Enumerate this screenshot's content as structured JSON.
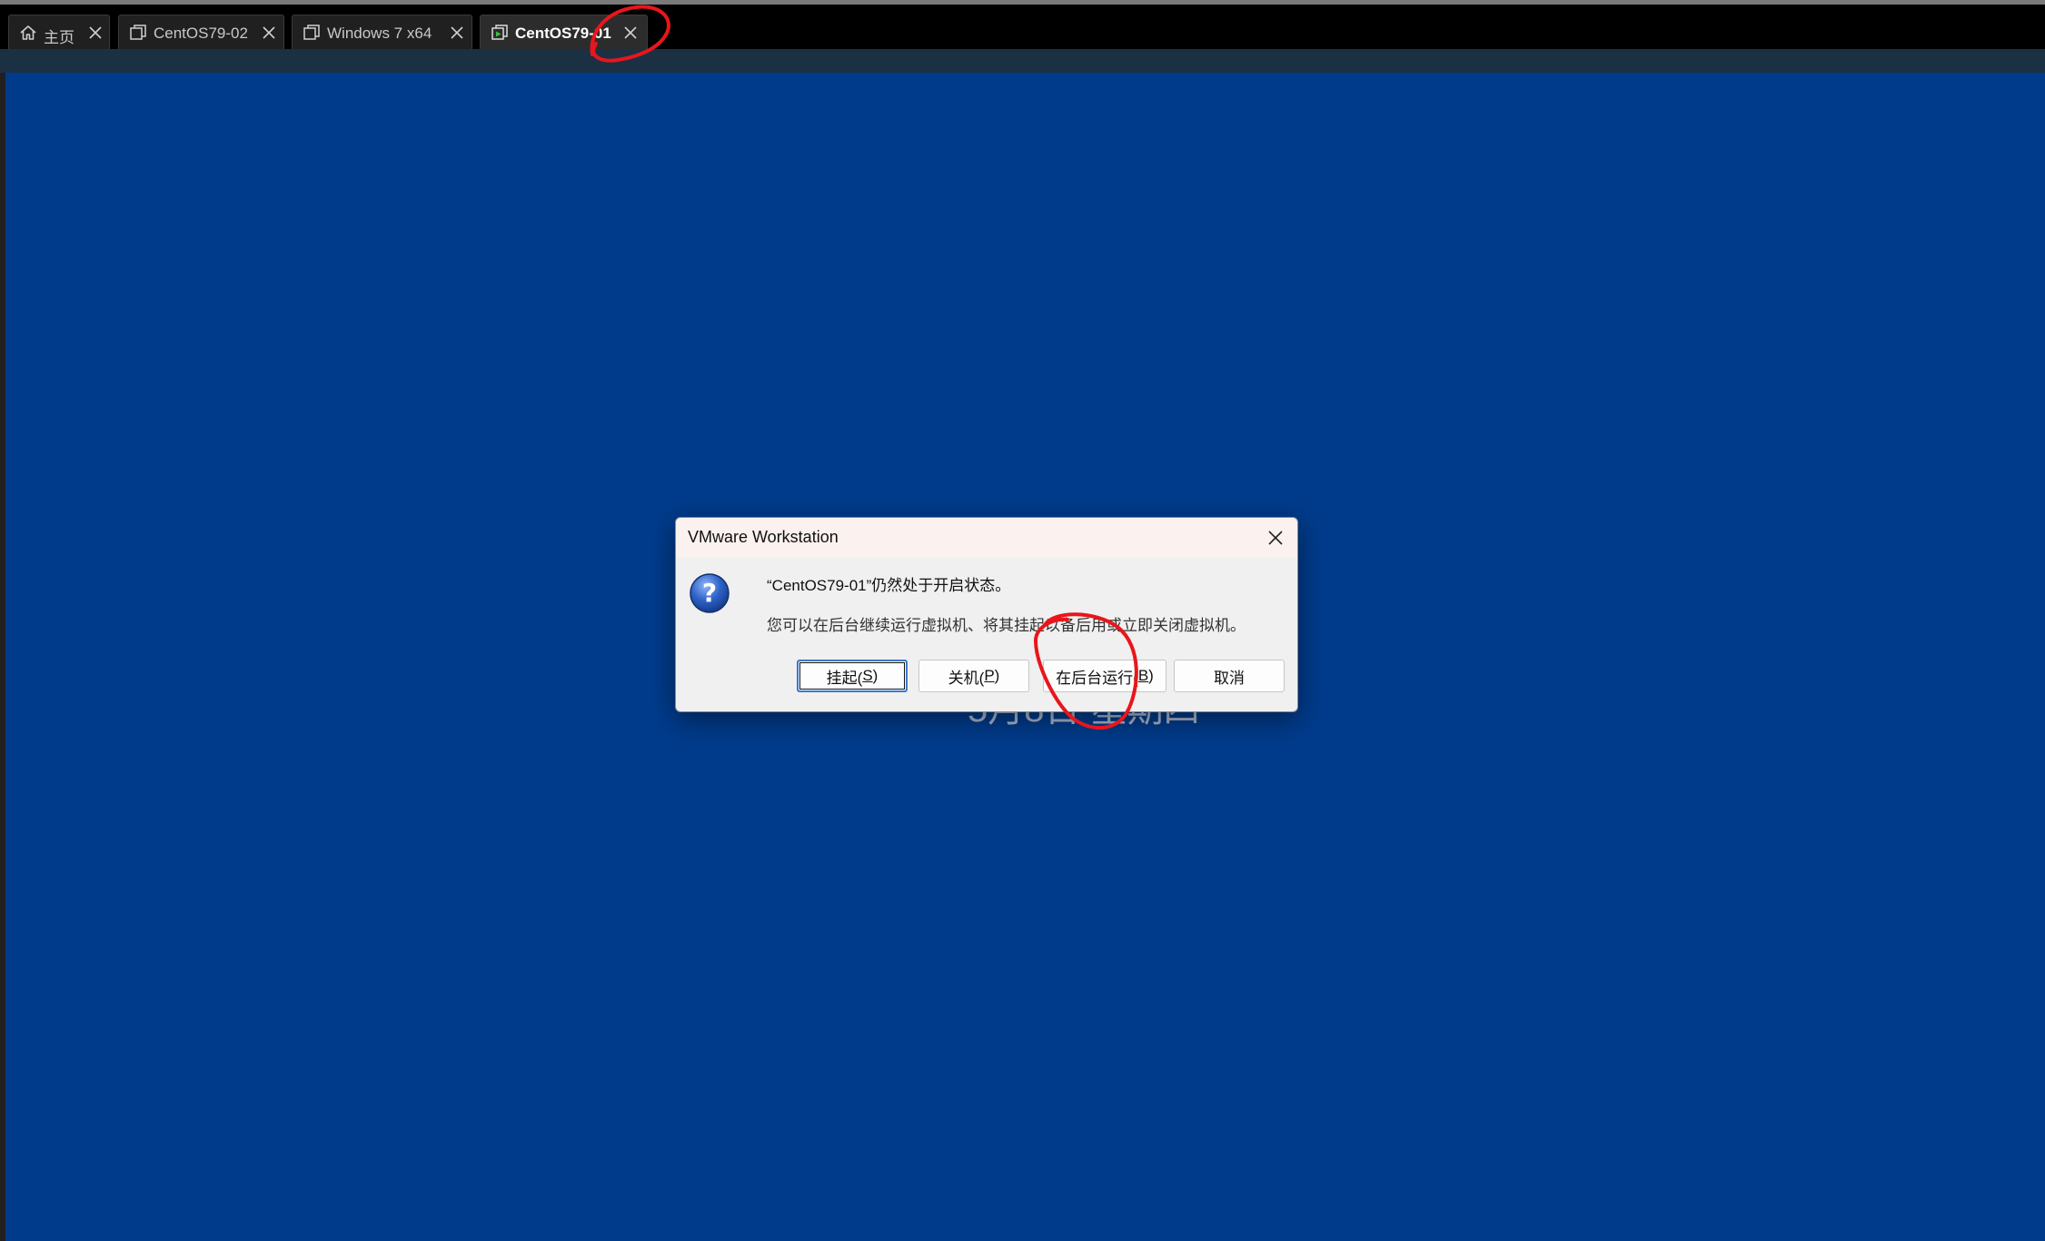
{
  "tabs": [
    {
      "label": "主页",
      "icon": "home-icon",
      "active": false
    },
    {
      "label": "CentOS79-02",
      "icon": "vm-window-icon",
      "active": false
    },
    {
      "label": "Windows 7 x64",
      "icon": "vm-window-icon",
      "active": false
    },
    {
      "label": "CentOS79-01",
      "icon": "vm-running-icon",
      "active": true
    }
  ],
  "vm_screen": {
    "date_text": "5月8日 星期四"
  },
  "dialog": {
    "title": "VMware Workstation",
    "message_line1": "“CentOS79-01”仍然处于开启状态。",
    "message_line2": "您可以在后台继续运行虚拟机、将其挂起以备后用或立即关闭虚拟机。",
    "icon": "question-icon",
    "buttons": {
      "suspend_text": "挂起(",
      "suspend_key": "S",
      "suspend_end": ")",
      "poweroff_text": "关机(",
      "poweroff_key": "P",
      "poweroff_end": ")",
      "background_text": "在后台运行(",
      "background_key": "B",
      "background_end": ")",
      "cancel": "取消"
    }
  },
  "colors": {
    "vm_background": "#003b8b",
    "annotation_red": "#e8161b",
    "default_button_border": "#3c78c8",
    "running_icon_green": "#3cc23c"
  }
}
